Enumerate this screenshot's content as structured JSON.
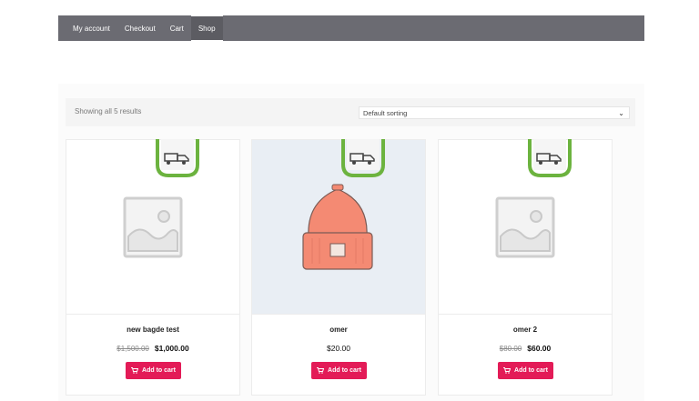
{
  "nav": {
    "items": [
      {
        "label": "My account"
      },
      {
        "label": "Checkout"
      },
      {
        "label": "Cart"
      },
      {
        "label": "Shop"
      }
    ],
    "active": "Shop"
  },
  "toolbar": {
    "result_count": "Showing all 5 results",
    "sorting_selected": "Default sorting"
  },
  "products": [
    {
      "title": "new bagde test",
      "old_price": "$1,500.00",
      "price": "$1,000.00",
      "button": "Add to cart",
      "image": "placeholder-image-icon",
      "badge": "delivery-truck-icon"
    },
    {
      "title": "omer",
      "price": "$20.00",
      "button": "Add to cart",
      "image": "beanie-hat-image",
      "badge": "delivery-truck-icon"
    },
    {
      "title": "omer 2",
      "old_price": "$80.00",
      "price": "$60.00",
      "button": "Add to cart",
      "image": "placeholder-image-icon",
      "badge": "delivery-truck-icon"
    }
  ],
  "colors": {
    "nav_bg": "#6b6b72",
    "button_bg": "#e31b57",
    "badge_green": "#6cb33f",
    "hat_color": "#f48a73"
  }
}
